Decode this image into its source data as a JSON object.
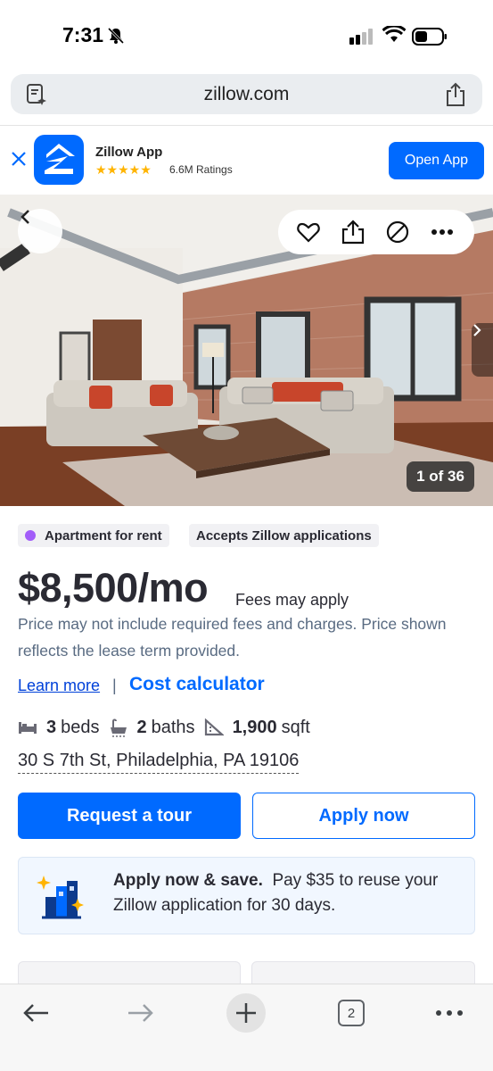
{
  "status_bar": {
    "time": "7:31"
  },
  "browser": {
    "url": "zillow.com",
    "tab_count": "2"
  },
  "app_banner": {
    "name": "Zillow App",
    "stars": "★★★★★",
    "rating_count": "6.6M Ratings",
    "open_label": "Open App",
    "brand_color": "#006aff"
  },
  "gallery": {
    "counter": "1 of 36"
  },
  "listing": {
    "tags": [
      {
        "label": "Apartment for rent"
      },
      {
        "label": "Accepts Zillow applications"
      }
    ],
    "price": "$8,500/mo",
    "fees_note": "Fees may apply",
    "disclaimer": "Price may not include required fees and charges. Price shown reflects the lease term provided.",
    "learn_more": "Learn more",
    "divider": "|",
    "cost_calculator": "Cost calculator",
    "beds_value": "3",
    "beds_unit": "beds",
    "baths_value": "2",
    "baths_unit": "baths",
    "sqft_value": "1,900",
    "sqft_unit": "sqft",
    "address": "30 S 7th St, Philadelphia, PA 19106"
  },
  "actions": {
    "request_tour": "Request a tour",
    "apply_now": "Apply now"
  },
  "promo": {
    "title": "Apply now & save.",
    "body": "Pay $35 to reuse your Zillow application for 30 days."
  },
  "colors": {
    "accent": "#006aff",
    "tag_dot": "#a25df9",
    "link": "#0041d9"
  }
}
